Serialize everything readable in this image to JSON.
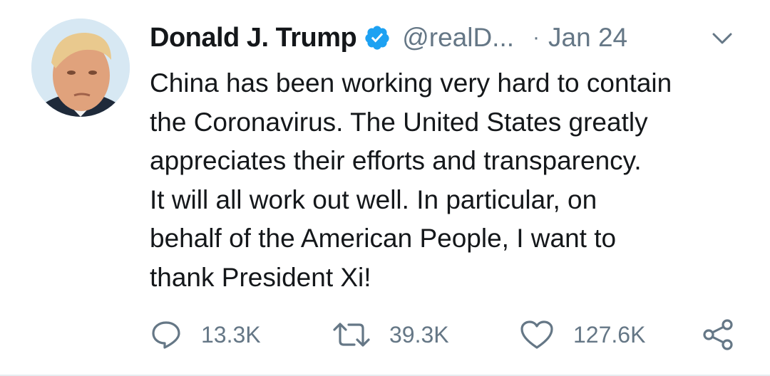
{
  "tweet": {
    "author": {
      "name": "Donald J. Trump",
      "handle": "@realD...",
      "verified": true
    },
    "separator": "·",
    "date": "Jan 24",
    "lines": [
      "China has been working very hard to contain",
      "the Coronavirus. The United States greatly",
      "appreciates their efforts and transparency.",
      "It will all work out well. In particular, on",
      "behalf of the American People, I want to",
      "thank President Xi!"
    ],
    "actions": {
      "reply": {
        "icon": "reply-icon",
        "count": "13.3K"
      },
      "retweet": {
        "icon": "retweet-icon",
        "count": "39.3K"
      },
      "like": {
        "icon": "heart-icon",
        "count": "127.6K"
      },
      "share": {
        "icon": "share-icon"
      }
    }
  },
  "colors": {
    "text": "#14171a",
    "secondary": "#657786",
    "verified": "#1da1f2"
  }
}
